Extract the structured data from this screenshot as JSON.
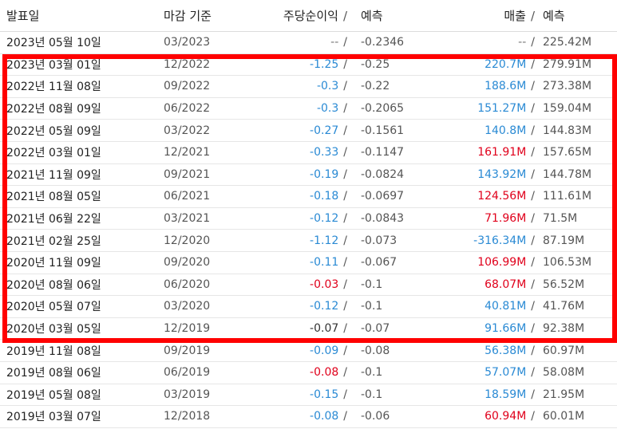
{
  "header": {
    "date": "발표일",
    "period": "마감 기준",
    "eps": "주당순이익",
    "eps_est": "예측",
    "revenue": "매출",
    "rev_est": "예측",
    "sep": "/"
  },
  "rows": [
    {
      "date": "2023년 05월 10일",
      "period": "03/2023",
      "eps": "--",
      "eps_est": "-0.2346",
      "rev": "--",
      "rev_est": "225.42M",
      "eps_color": "gray",
      "rev_color": "gray"
    },
    {
      "date": "2023년 03월 01일",
      "period": "12/2022",
      "eps": "-1.25",
      "eps_est": "-0.25",
      "rev": "220.7M",
      "rev_est": "279.91M",
      "eps_color": "blue",
      "rev_color": "blue"
    },
    {
      "date": "2022년 11월 08일",
      "period": "09/2022",
      "eps": "-0.3",
      "eps_est": "-0.22",
      "rev": "188.6M",
      "rev_est": "273.38M",
      "eps_color": "blue",
      "rev_color": "blue"
    },
    {
      "date": "2022년 08월 09일",
      "period": "06/2022",
      "eps": "-0.3",
      "eps_est": "-0.2065",
      "rev": "151.27M",
      "rev_est": "159.04M",
      "eps_color": "blue",
      "rev_color": "blue"
    },
    {
      "date": "2022년 05월 09일",
      "period": "03/2022",
      "eps": "-0.27",
      "eps_est": "-0.1561",
      "rev": "140.8M",
      "rev_est": "144.83M",
      "eps_color": "blue",
      "rev_color": "blue"
    },
    {
      "date": "2022년 03월 01일",
      "period": "12/2021",
      "eps": "-0.33",
      "eps_est": "-0.1147",
      "rev": "161.91M",
      "rev_est": "157.65M",
      "eps_color": "blue",
      "rev_color": "red"
    },
    {
      "date": "2021년 11월 09일",
      "period": "09/2021",
      "eps": "-0.19",
      "eps_est": "-0.0824",
      "rev": "143.92M",
      "rev_est": "144.78M",
      "eps_color": "blue",
      "rev_color": "blue"
    },
    {
      "date": "2021년 08월 05일",
      "period": "06/2021",
      "eps": "-0.18",
      "eps_est": "-0.0697",
      "rev": "124.56M",
      "rev_est": "111.61M",
      "eps_color": "blue",
      "rev_color": "red"
    },
    {
      "date": "2021년 06월 22일",
      "period": "03/2021",
      "eps": "-0.12",
      "eps_est": "-0.0843",
      "rev": "71.96M",
      "rev_est": "71.5M",
      "eps_color": "blue",
      "rev_color": "red"
    },
    {
      "date": "2021년 02월 25일",
      "period": "12/2020",
      "eps": "-1.12",
      "eps_est": "-0.073",
      "rev": "-316.34M",
      "rev_est": "87.19M",
      "eps_color": "blue",
      "rev_color": "blue"
    },
    {
      "date": "2020년 11월 09일",
      "period": "09/2020",
      "eps": "-0.11",
      "eps_est": "-0.067",
      "rev": "106.99M",
      "rev_est": "106.53M",
      "eps_color": "blue",
      "rev_color": "red"
    },
    {
      "date": "2020년 08월 06일",
      "period": "06/2020",
      "eps": "-0.03",
      "eps_est": "-0.1",
      "rev": "68.07M",
      "rev_est": "56.52M",
      "eps_color": "red",
      "rev_color": "red"
    },
    {
      "date": "2020년 05월 07일",
      "period": "03/2020",
      "eps": "-0.12",
      "eps_est": "-0.1",
      "rev": "40.81M",
      "rev_est": "41.76M",
      "eps_color": "blue",
      "rev_color": "blue"
    },
    {
      "date": "2020년 03월 05일",
      "period": "12/2019",
      "eps": "-0.07",
      "eps_est": "-0.07",
      "rev": "91.66M",
      "rev_est": "92.38M",
      "eps_color": "dark",
      "rev_color": "blue"
    },
    {
      "date": "2019년 11월 08일",
      "period": "09/2019",
      "eps": "-0.09",
      "eps_est": "-0.08",
      "rev": "56.38M",
      "rev_est": "60.97M",
      "eps_color": "blue",
      "rev_color": "blue"
    },
    {
      "date": "2019년 08월 06일",
      "period": "06/2019",
      "eps": "-0.08",
      "eps_est": "-0.1",
      "rev": "57.07M",
      "rev_est": "58.08M",
      "eps_color": "red",
      "rev_color": "blue"
    },
    {
      "date": "2019년 05월 08일",
      "period": "03/2019",
      "eps": "-0.15",
      "eps_est": "-0.1",
      "rev": "18.59M",
      "rev_est": "21.95M",
      "eps_color": "blue",
      "rev_color": "blue"
    },
    {
      "date": "2019년 03월 07일",
      "period": "12/2018",
      "eps": "-0.08",
      "eps_est": "-0.06",
      "rev": "60.94M",
      "rev_est": "60.01M",
      "eps_color": "blue",
      "rev_color": "red"
    }
  ],
  "colors": {
    "blue": "#2a8ad4",
    "red": "#e0001b",
    "highlight": "#ff0000"
  }
}
